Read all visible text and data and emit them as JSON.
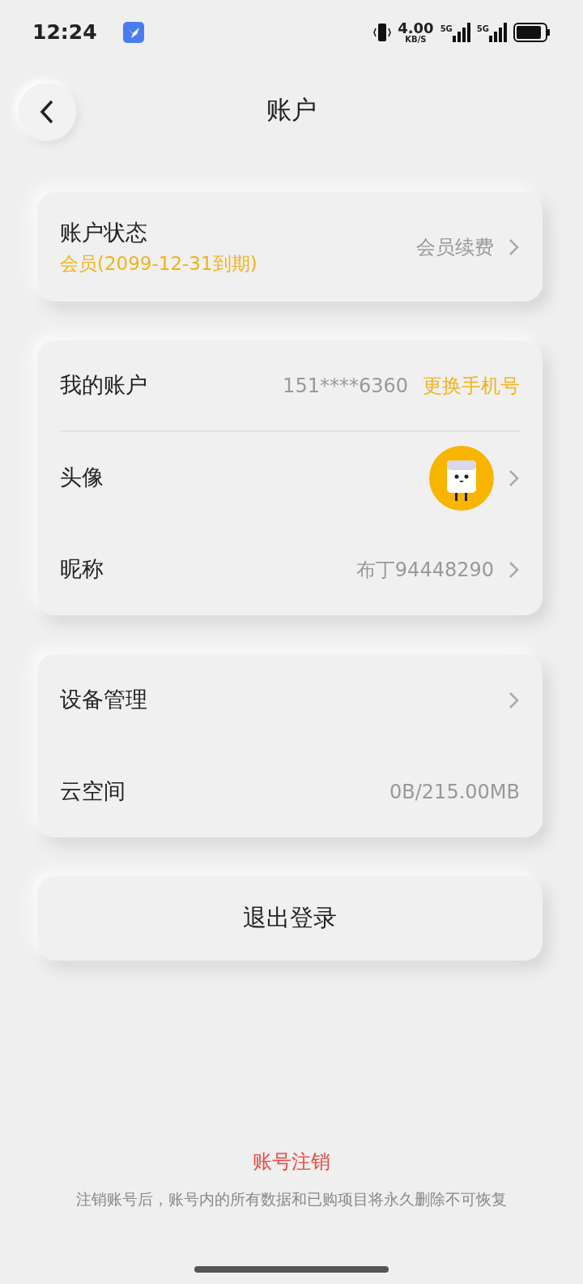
{
  "status_bar": {
    "time": "12:24",
    "speed": "4.00",
    "speed_unit": "KB/S",
    "signals": [
      "5G",
      "5G"
    ]
  },
  "header": {
    "title": "账户"
  },
  "sections": [
    {
      "rows": [
        {
          "kind": "status",
          "label": "账户状态",
          "sub": "会员(2099-12-31到期)",
          "value": "会员续费",
          "chevron": true
        }
      ]
    },
    {
      "rows": [
        {
          "kind": "phone",
          "label": "我的账户",
          "value": "151****6360",
          "action": "更换手机号",
          "chevron": false,
          "divider": true
        },
        {
          "kind": "avatar",
          "label": "头像",
          "chevron": true
        },
        {
          "kind": "text",
          "label": "昵称",
          "value": "布丁94448290",
          "chevron": true
        }
      ]
    },
    {
      "rows": [
        {
          "kind": "text",
          "label": "设备管理",
          "chevron": true
        },
        {
          "kind": "text",
          "label": "云空间",
          "value": "0B/215.00MB",
          "chevron": false
        }
      ]
    }
  ],
  "logout": "退出登录",
  "delete_account": {
    "link": "账号注销",
    "note": "注销账号后，账号内的所有数据和已购项目将永久删除不可恢复"
  }
}
